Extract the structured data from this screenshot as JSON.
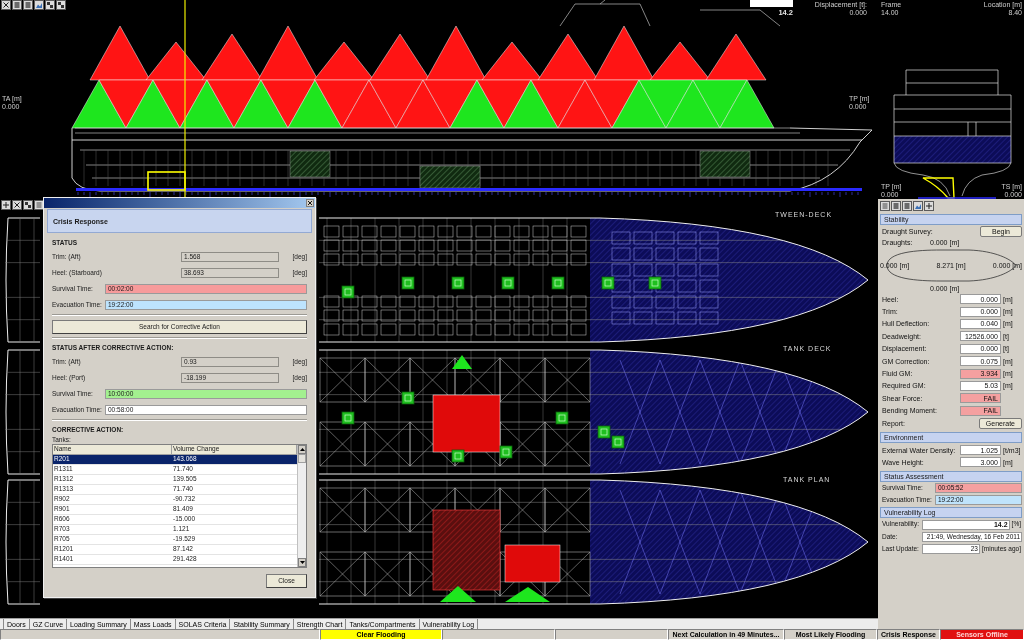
{
  "profile_view": {
    "ta_label": "TA [m]",
    "ta_value": "0.000",
    "tp_label": "TP [m]",
    "tp_value": "0.000",
    "gauge_value": "14.2",
    "displacement_label": "Displacement [t]:",
    "displacement_value": "0.000"
  },
  "section_view": {
    "frame_label": "Frame",
    "frame_value": "14.00",
    "location_label": "Location [m]",
    "location_value": "8.40",
    "tp_label": "TP [m]",
    "tp_value": "0.000",
    "ts_label": "TS [m]",
    "ts_value": "0.000"
  },
  "deck_plans": [
    {
      "label": "TWEEN-DECK"
    },
    {
      "label": "TANK DECK"
    },
    {
      "label": "TANK PLAN"
    }
  ],
  "crisis_dialog": {
    "title": "Crisis Response",
    "status_heading": "STATUS",
    "status_readings": [
      {
        "label": "Trim: (Aft)",
        "value": "1.568",
        "unit": "[deg]"
      },
      {
        "label": "Heel: (Starboard)",
        "value": "38.693",
        "unit": "[deg]"
      }
    ],
    "status_times": [
      {
        "label": "Survival Time:",
        "value": "00:02:00",
        "color": "#f79b9b"
      },
      {
        "label": "Evacuation Time:",
        "value": "19:22:00",
        "color": "#bde3fd"
      }
    ],
    "search_button": "Search for Corrective Action",
    "after_heading": "STATUS AFTER CORRECTIVE ACTION:",
    "after_readings": [
      {
        "label": "Trim: (Aft)",
        "value": "0.93",
        "unit": "[deg]"
      },
      {
        "label": "Heel: (Port)",
        "value": "-18.199",
        "unit": "[deg]"
      }
    ],
    "after_times": [
      {
        "label": "Survival Time:",
        "value": "10:00:00",
        "color": "#a3f08f"
      },
      {
        "label": "Evacuation Time:",
        "value": "00:58:00",
        "color": "#ffffff"
      }
    ],
    "action_heading": "CORRECTIVE ACTION:",
    "tanks_label": "Tanks:",
    "columns": [
      "Name",
      "Volume Change"
    ],
    "rows": [
      {
        "name": "R201",
        "volume_change": "143.068",
        "selected": true
      },
      {
        "name": "R1311",
        "volume_change": "71.740",
        "selected": false
      },
      {
        "name": "R1312",
        "volume_change": "139.505",
        "selected": false
      },
      {
        "name": "R1313",
        "volume_change": "71.740",
        "selected": false
      },
      {
        "name": "R902",
        "volume_change": "-90.732",
        "selected": false
      },
      {
        "name": "R901",
        "volume_change": "81.409",
        "selected": false
      },
      {
        "name": "R606",
        "volume_change": "-15.000",
        "selected": false
      },
      {
        "name": "R703",
        "volume_change": "1.121",
        "selected": false
      },
      {
        "name": "R705",
        "volume_change": "-19.529",
        "selected": false
      },
      {
        "name": "R1201",
        "volume_change": "87.142",
        "selected": false
      },
      {
        "name": "R1401",
        "volume_change": "291.428",
        "selected": false
      }
    ],
    "close_button": "Close"
  },
  "right_panel": {
    "stability": {
      "title": "Stability",
      "survey_label": "Draught Survey:",
      "survey_button": "Begin",
      "draughts_label": "Draughts:",
      "draught_top": "0.000 [m]",
      "draught_left": "0.000 [m]",
      "draught_center": "8.271 [m]",
      "draught_right": "0.000 [m]",
      "draught_bottom": "0.000 [m]",
      "rows": [
        {
          "label": "Heel:",
          "value": "0.000",
          "unit": "[m]",
          "color": "#ffffff"
        },
        {
          "label": "Trim:",
          "value": "0.000",
          "unit": "[m]",
          "color": "#ffffff"
        },
        {
          "label": "Hull Deflection:",
          "value": "0.040",
          "unit": "[m]",
          "color": "#ffffff"
        },
        {
          "label": "Deadweight:",
          "value": "12526.000",
          "unit": "[t]",
          "color": "#ffffff"
        },
        {
          "label": "Displacement:",
          "value": "0.000",
          "unit": "[t]",
          "color": "#ffffff"
        },
        {
          "label": "GM Correction:",
          "value": "0.075",
          "unit": "[m]",
          "color": "#ffffff"
        },
        {
          "label": "Fluid GM:",
          "value": "3.934",
          "unit": "[m]",
          "color": "#f4a0a0"
        },
        {
          "label": "Required GM:",
          "value": "5.03",
          "unit": "[m]",
          "color": "#ffffff"
        },
        {
          "label": "Shear Force:",
          "value": "FAIL",
          "color": "#f4a0a0"
        },
        {
          "label": "Bending Moment:",
          "value": "FAIL",
          "color": "#f4a0a0"
        }
      ],
      "report_label": "Report:",
      "report_button": "Generate"
    },
    "environment": {
      "title": "Environment",
      "rows": [
        {
          "label": "External Water Density:",
          "value": "1.025",
          "unit": "[t/m3]",
          "color": "#ffffff"
        },
        {
          "label": "Wave Height:",
          "value": "3.000",
          "unit": "[m]",
          "color": "#ffffff"
        }
      ]
    },
    "status_assessment": {
      "title": "Status Assessment",
      "rows": [
        {
          "label": "Survival Time:",
          "value": "00:05:52",
          "color": "#f4a0a0"
        },
        {
          "label": "Evacuation Time:",
          "value": "19:22:00",
          "color": "#bfe3fb"
        }
      ]
    },
    "vulnerability_log": {
      "title": "Vulnerability Log",
      "rows": [
        {
          "label": "Vulnerability:",
          "value": "14.2",
          "unit": "[%]",
          "bold": true
        },
        {
          "label": "Date:",
          "value": "21:49, Wednesday, 16 Feb 2011",
          "bold": false
        },
        {
          "label": "Last Update:",
          "value": "23",
          "unit": "[minutes ago]",
          "bold": false
        }
      ]
    }
  },
  "tabs": [
    "Doors",
    "GZ Curve",
    "Loading Summary",
    "Mass Loads",
    "SOLAS Criteria",
    "Stability Summary",
    "Strength Chart",
    "Tanks/Compartments",
    "Vulnerability Log"
  ],
  "status_bar": [
    {
      "kind": "blank"
    },
    {
      "kind": "text",
      "text": "Clear Flooding",
      "color": "#ffff00"
    },
    {
      "kind": "blank"
    },
    {
      "kind": "blank"
    },
    {
      "kind": "text",
      "text": "Next Calculation in 49 Minutes...",
      "color": "#d4d0c8"
    },
    {
      "kind": "text",
      "text": "Most Likely Flooding",
      "color": "#d4d0c8"
    },
    {
      "kind": "text",
      "text": "Crisis Response",
      "color": "#d4d0c8"
    },
    {
      "kind": "text",
      "text": "Sensors Offline",
      "color": "#e01010"
    }
  ]
}
